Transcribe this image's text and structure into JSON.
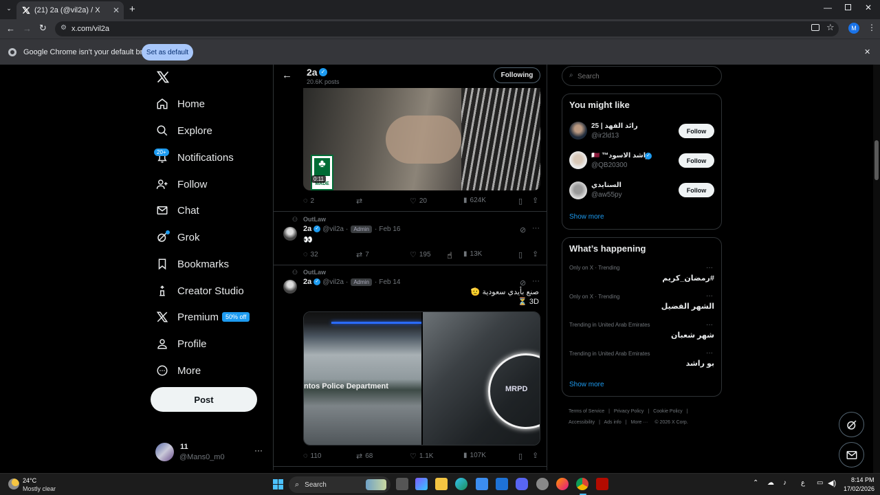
{
  "browser": {
    "tab_title": "(21) 2a (@vil2a) / X",
    "url": "x.com/vil2a",
    "infobar_message": "Google Chrome isn't your default browser",
    "infobar_button": "Set as default",
    "profile_initial": "M"
  },
  "sidebar": {
    "items": [
      {
        "label": "Home",
        "icon": "home-icon"
      },
      {
        "label": "Explore",
        "icon": "search-icon"
      },
      {
        "label": "Notifications",
        "icon": "bell-icon",
        "badge": "20+"
      },
      {
        "label": "Follow",
        "icon": "person-plus-icon"
      },
      {
        "label": "Chat",
        "icon": "envelope-icon"
      },
      {
        "label": "Grok",
        "icon": "grok-icon"
      },
      {
        "label": "Bookmarks",
        "icon": "bookmark-icon"
      },
      {
        "label": "Creator Studio",
        "icon": "creator-icon"
      },
      {
        "label": "Premium",
        "icon": "x-icon",
        "badge": "50% off"
      },
      {
        "label": "Profile",
        "icon": "person-icon"
      },
      {
        "label": "More",
        "icon": "more-circle-icon"
      }
    ],
    "post_label": "Post",
    "account": {
      "name": "‪‬",
      "handle": "@Mans0_m0",
      "name_display": "11"
    }
  },
  "header": {
    "name": "2a",
    "posts": "20.6K posts",
    "follow_state": "Following"
  },
  "tweets": [
    {
      "video_time": "0:11",
      "replies": "2",
      "retweets": "",
      "likes": "20",
      "views": "624K"
    },
    {
      "context": "OutLaw",
      "name": "2a",
      "handle": "@vil2a",
      "role": "Admin",
      "date": "Feb 16",
      "text": "👀",
      "replies": "32",
      "retweets": "7",
      "likes": "195",
      "views": "13K"
    },
    {
      "context": "OutLaw",
      "name": "2a",
      "handle": "@vil2a",
      "role": "Admin",
      "date": "Feb 14",
      "text_line1": "صنع بأيدي سعودية 🫡",
      "text_line2": "⏳ 3D",
      "image_left_text": "ntos Police Department",
      "image_right_text": "MRPD",
      "replies": "110",
      "retweets": "68",
      "likes": "1.1K",
      "views": "107K"
    }
  ],
  "right": {
    "search_placeholder": "Search",
    "might_like_title": "You might like",
    "suggestions": [
      {
        "name": "رائد الفهد | 25",
        "handle": "@ir2ld13",
        "button": "Follow"
      },
      {
        "name": "راشد الاسود™ 🇶🇦",
        "handle": "@QB20300",
        "button": "Follow"
      },
      {
        "name": "السنايدي",
        "handle": "@aw55py",
        "button": "Follow"
      }
    ],
    "show_more": "Show more",
    "happening_title": "What’s happening",
    "trends": [
      {
        "context": "Only on X · Trending",
        "name": "#رمضان_كريم"
      },
      {
        "context": "Only on X · Trending",
        "name": "الشهر الفضيل"
      },
      {
        "context": "Trending in United Arab Emirates",
        "name": "شهر شعبان"
      },
      {
        "context": "Trending in United Arab Emirates",
        "name": "بو راشد"
      }
    ],
    "footer": [
      "Terms of Service",
      "|",
      "Privacy Policy",
      "|",
      "Cookie Policy",
      "|",
      "Accessibility",
      "|",
      "Ads info",
      "|",
      "More ···",
      "© 2026 X Corp."
    ]
  },
  "taskbar": {
    "weather_temp": "24°C",
    "weather_desc": "Mostly clear",
    "search": "Search",
    "time": "8:14 PM",
    "date": "17/02/2026",
    "lang": "ع"
  },
  "colors": {
    "accent": "#1d9bf0",
    "background": "#000000",
    "text": "#e7e9ea",
    "muted": "#71767b",
    "border": "#2f3336"
  }
}
